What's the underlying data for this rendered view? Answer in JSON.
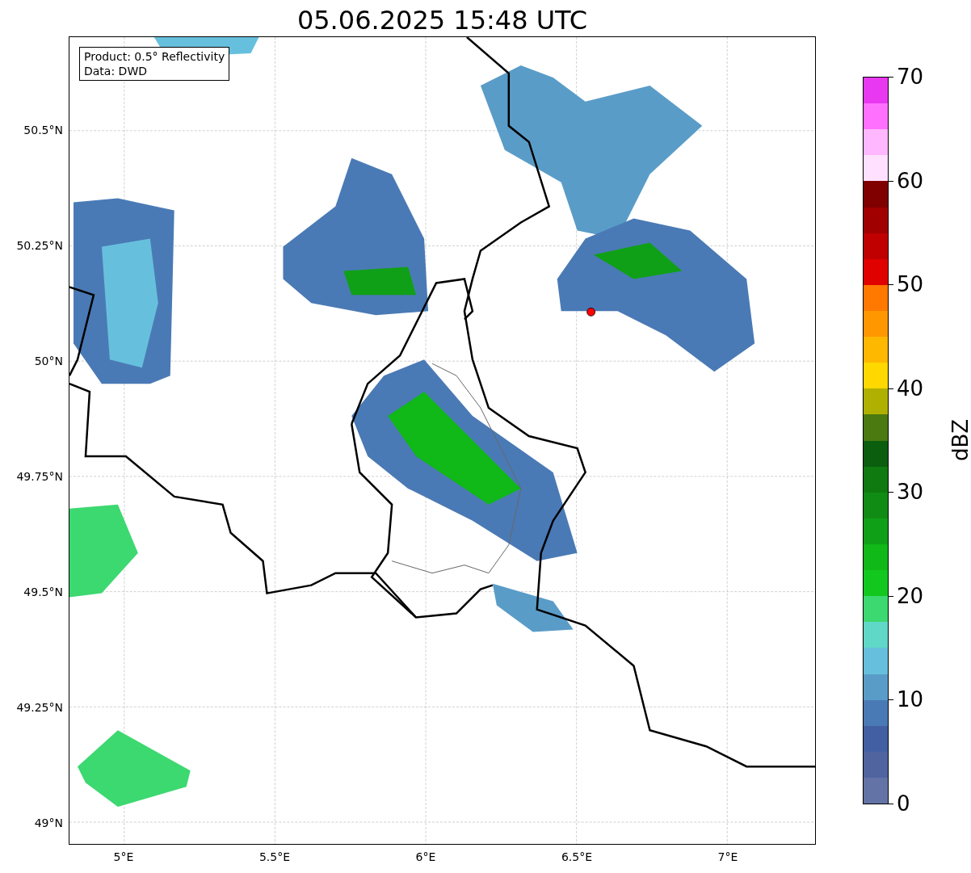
{
  "title": "05.06.2025 15:48 UTC",
  "info_box": [
    "Product: 0.5° Reflectivity",
    "Data: DWD"
  ],
  "map": {
    "x_ticks": [
      "5°E",
      "5.5°E",
      "6°E",
      "6.5°E",
      "7°E"
    ],
    "y_ticks": [
      "50.5°N",
      "50.25°N",
      "50°N",
      "49.75°N",
      "49.5°N",
      "49.25°N",
      "49°N"
    ]
  },
  "colorbar": {
    "label": "dBZ",
    "ticks": [
      "70",
      "60",
      "50",
      "40",
      "30",
      "20",
      "10",
      "0"
    ],
    "segments": [
      {
        "color": "#e838f0"
      },
      {
        "color": "#ff70ff"
      },
      {
        "color": "#ffb8ff"
      },
      {
        "color": "#ffe0ff"
      },
      {
        "color": "#800000"
      },
      {
        "color": "#a00000"
      },
      {
        "color": "#c00000"
      },
      {
        "color": "#e00000"
      },
      {
        "color": "#ff7800"
      },
      {
        "color": "#ff9800"
      },
      {
        "color": "#ffb800"
      },
      {
        "color": "#ffd800"
      },
      {
        "color": "#b0b000"
      },
      {
        "color": "#4a7a10"
      },
      {
        "color": "#0a5e0e"
      },
      {
        "color": "#0f7a10"
      },
      {
        "color": "#108c14"
      },
      {
        "color": "#10a018"
      },
      {
        "color": "#10b818"
      },
      {
        "color": "#12c81f"
      },
      {
        "color": "#3cd870"
      },
      {
        "color": "#60d8c8"
      },
      {
        "color": "#66c0dd"
      },
      {
        "color": "#5a9cc8"
      },
      {
        "color": "#4a7ab5"
      },
      {
        "color": "#435fa3"
      },
      {
        "color": "#5064a0"
      },
      {
        "color": "#6373a5"
      }
    ]
  }
}
